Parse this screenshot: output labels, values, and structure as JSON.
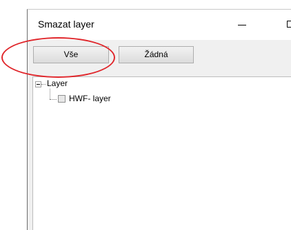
{
  "window": {
    "title": "Smazat layer"
  },
  "toolbar": {
    "all_label": "Vše",
    "none_label": "Žádná"
  },
  "tree": {
    "root_label": "Layer",
    "child_label": "HWF- layer",
    "child_checked": false
  },
  "annotation": {
    "color": "#e0262b"
  }
}
